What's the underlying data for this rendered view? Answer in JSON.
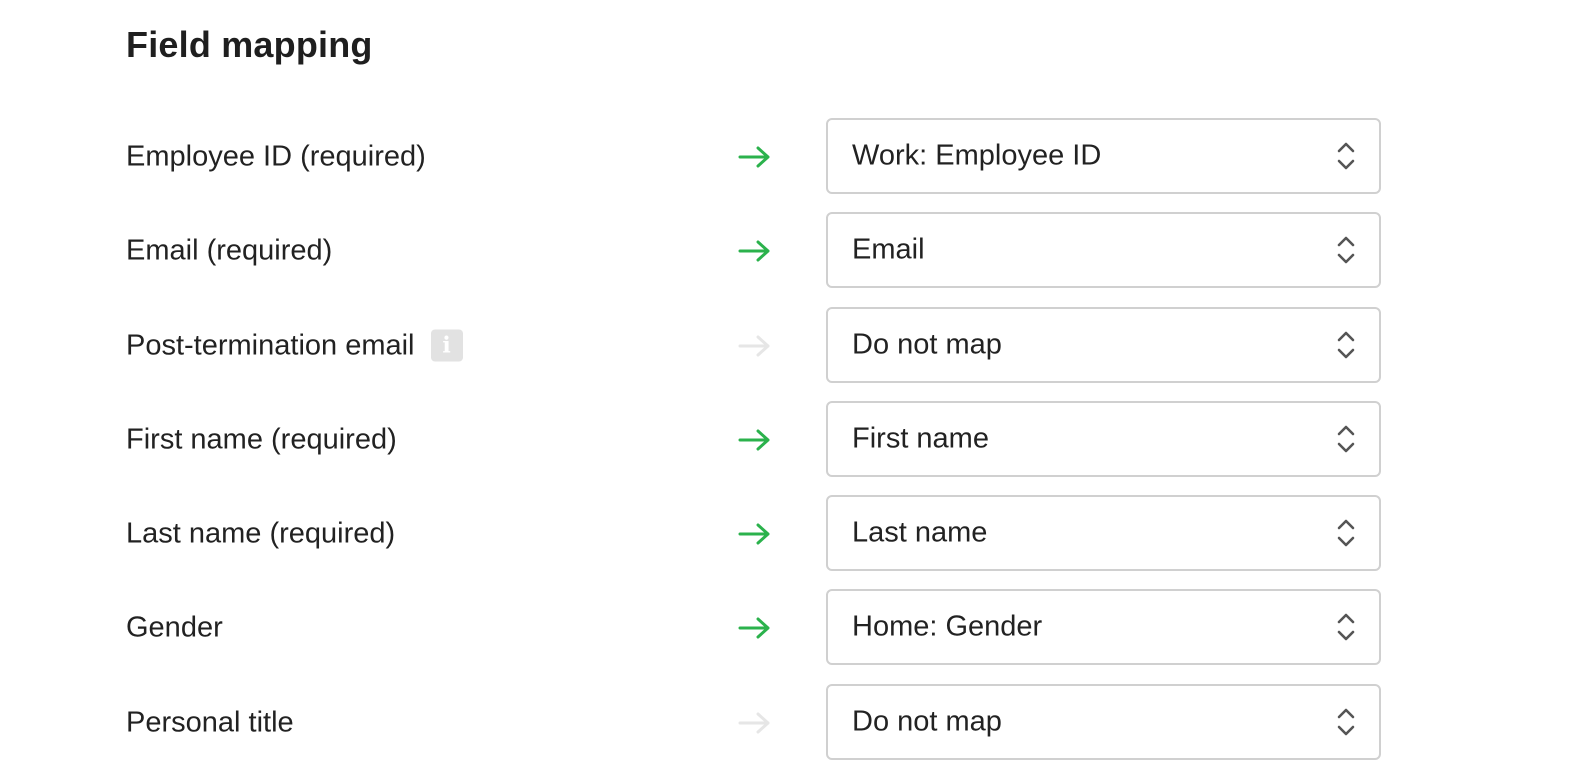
{
  "section": {
    "title": "Field mapping"
  },
  "colors": {
    "arrow_active": "#2bb24c",
    "arrow_inactive": "#e6e6e6",
    "select_border": "#d0d0d0",
    "info_bg": "#e2e2e2"
  },
  "rows": [
    {
      "label": "Employee ID (required)",
      "value": "Work: Employee ID",
      "mapped": true
    },
    {
      "label": "Email (required)",
      "value": "Email",
      "mapped": true
    },
    {
      "label": "Post-termination email",
      "value": "Do not map",
      "mapped": false,
      "has_info": true,
      "info_icon": "info-icon"
    },
    {
      "label": "First name (required)",
      "value": "First name",
      "mapped": true
    },
    {
      "label": "Last name (required)",
      "value": "Last name",
      "mapped": true
    },
    {
      "label": "Gender",
      "value": "Home: Gender",
      "mapped": true
    },
    {
      "label": "Personal title",
      "value": "Do not map",
      "mapped": false
    }
  ]
}
